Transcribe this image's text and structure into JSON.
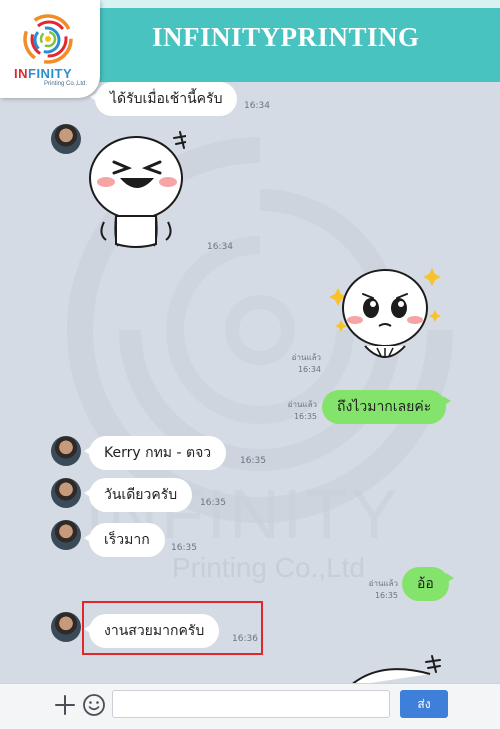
{
  "header": {
    "brand_title": "INFINITYPRINTING",
    "logo_name_in": "IN",
    "logo_name_rest": "FINITY",
    "logo_subtitle": "Printing Co.,Ltd."
  },
  "watermark": {
    "line1": "INFINITY",
    "line2": "Printing Co.,Ltd"
  },
  "messages": [
    {
      "text": "ได้รับเมื่อเช้านี้ครับ",
      "time": "16:34"
    },
    {
      "sticker": "laughing-sticker",
      "time": "16:34"
    },
    {
      "sticker": "teary-sticker",
      "read": "อ่านแล้ว",
      "time": "16:34"
    },
    {
      "text": "ถึงไวมากเลยค่ะ",
      "read": "อ่านแล้ว",
      "time": "16:35"
    },
    {
      "text": "Kerry กทม - ตจว",
      "time": "16:35"
    },
    {
      "text": "วันเดียวครับ",
      "time": "16:35"
    },
    {
      "text": "เร็วมาก",
      "time": "16:35"
    },
    {
      "text": "อ้อ",
      "read": "อ่านแล้ว",
      "time": "16:35"
    },
    {
      "text": "งานสวยมากครับ",
      "time": "16:36"
    }
  ],
  "composer": {
    "send_label": "ส่ง",
    "icons": [
      "plus-icon",
      "emoji-icon"
    ]
  },
  "colors": {
    "header": "#48c3c0",
    "outgoing_bubble": "#84e36b",
    "send_button": "#3d7fd9",
    "highlight": "#e0272d"
  }
}
